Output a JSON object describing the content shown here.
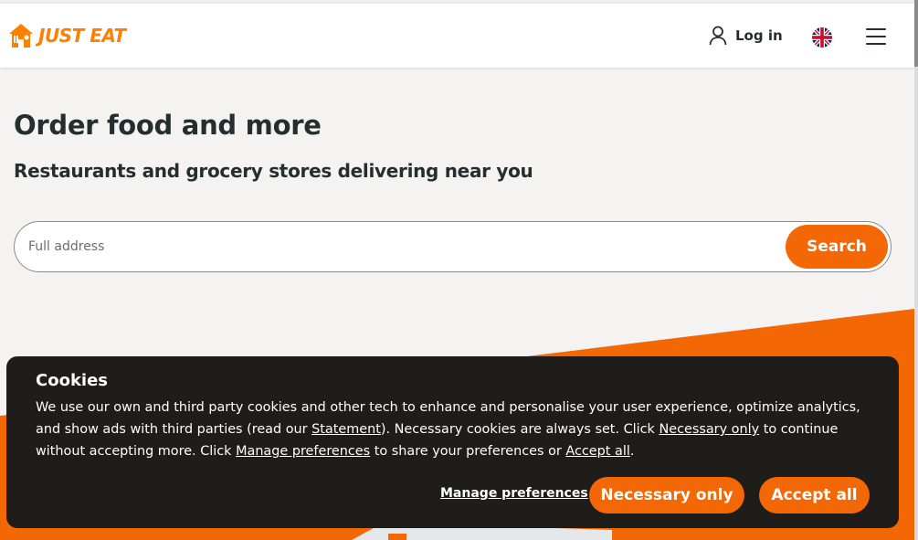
{
  "header": {
    "logo_text": "JUST EAT",
    "login_label": "Log in"
  },
  "hero": {
    "title": "Order food and more",
    "subtitle": "Restaurants and grocery stores delivering near you"
  },
  "search": {
    "placeholder": "Full address",
    "button_label": "Search"
  },
  "cookie_banner": {
    "title": "Cookies",
    "text_1": "We use our own and third party cookies and other tech to enhance and personalise your user experience, optimize analytics, and show ads with third parties (read our ",
    "statement_link": "Statement",
    "text_2": "). Necessary cookies are always set. Click ",
    "necessary_link": "Necessary only",
    "text_3": " to continue without accepting more. Click ",
    "manage_link": "Manage preferences",
    "text_4": " to share your preferences or ",
    "accept_link": "Accept all",
    "text_5": ".",
    "manage_button": "Manage preferences",
    "necessary_button": "Necessary only",
    "accept_button": "Accept all"
  },
  "colors": {
    "brand_orange": "#f36805",
    "logo_orange": "#ff8000",
    "banner_bg": "#1f1d1a",
    "page_bg": "#f5f3f1"
  },
  "icons": {
    "logo": "house-icon",
    "login": "user-icon",
    "language": "uk-flag-icon",
    "menu": "hamburger-menu-icon"
  }
}
